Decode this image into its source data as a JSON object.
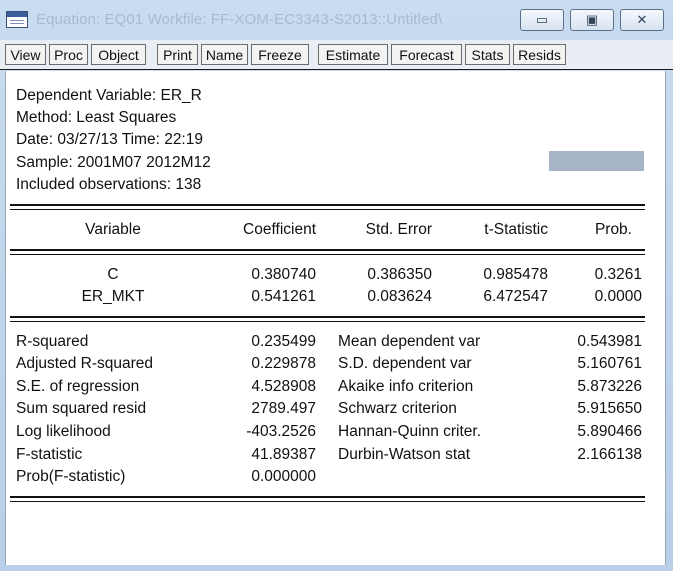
{
  "window": {
    "title": "Equation: EQ01   Workfile: FF-XOM-EC3343-S2013::Untitled\\",
    "minimize_label": "▭",
    "maximize_label": "▣",
    "close_label": "✕"
  },
  "toolbar": {
    "buttons": [
      "View",
      "Proc",
      "Object",
      "Print",
      "Name",
      "Freeze",
      "Estimate",
      "Forecast",
      "Stats",
      "Resids"
    ]
  },
  "header": {
    "dependent": "Dependent Variable: ER_R",
    "method": "Method: Least Squares",
    "date": "Date: 03/27/13   Time: 22:19",
    "sample": "Sample: 2001M07 2012M12",
    "observations": "Included observations: 138"
  },
  "coef_table": {
    "columns": [
      "Variable",
      "Coefficient",
      "Std. Error",
      "t-Statistic",
      "Prob."
    ],
    "rows": [
      [
        "C",
        "0.380740",
        "0.386350",
        "0.985478",
        "0.3261"
      ],
      [
        "ER_MKT",
        "0.541261",
        "0.083624",
        "6.472547",
        "0.0000"
      ]
    ]
  },
  "stats": {
    "left": [
      [
        "R-squared",
        "0.235499"
      ],
      [
        "Adjusted R-squared",
        "0.229878"
      ],
      [
        "S.E. of regression",
        "4.528908"
      ],
      [
        "Sum squared resid",
        "2789.497"
      ],
      [
        "Log likelihood",
        "-403.2526"
      ],
      [
        "F-statistic",
        "41.89387"
      ],
      [
        "Prob(F-statistic)",
        "0.000000"
      ]
    ],
    "right": [
      [
        "Mean dependent var",
        "0.543981"
      ],
      [
        "S.D. dependent var",
        "5.160761"
      ],
      [
        "Akaike info criterion",
        "5.873226"
      ],
      [
        "Schwarz criterion",
        "5.915650"
      ],
      [
        "Hannan-Quinn criter.",
        "5.890466"
      ],
      [
        "Durbin-Watson stat",
        "2.166138"
      ]
    ]
  }
}
